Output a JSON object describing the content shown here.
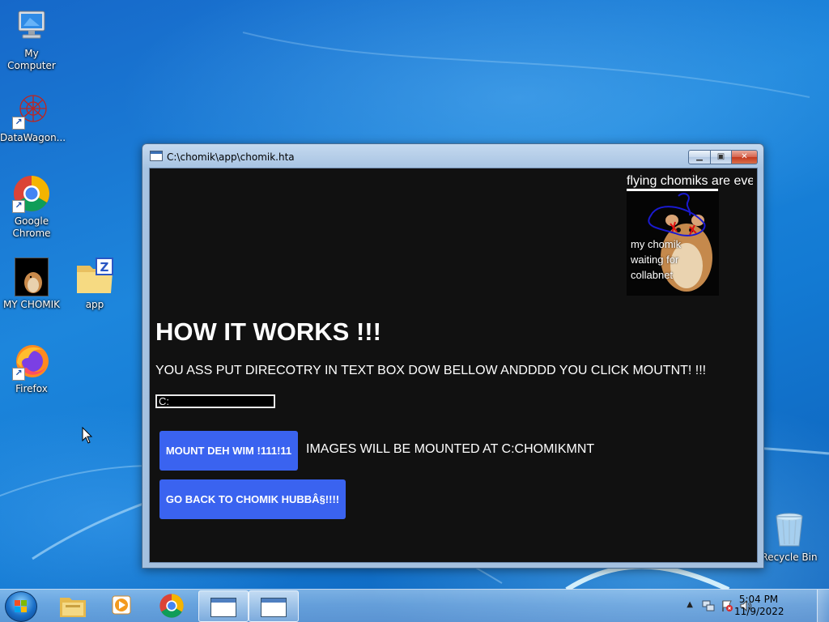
{
  "desktop": {
    "icons": [
      {
        "label": "My Computer",
        "icon": "computer-icon"
      },
      {
        "label": "DataWagon...",
        "icon": "datawagon-icon"
      },
      {
        "label": "Google Chrome",
        "icon": "chrome-icon"
      },
      {
        "label": "MY CHOMIK",
        "icon": "hamster-image-icon"
      },
      {
        "label": "app",
        "icon": "folder-zip-icon"
      },
      {
        "label": "Firefox",
        "icon": "firefox-icon"
      },
      {
        "label": "Recycle Bin",
        "icon": "recycle-bin-icon"
      }
    ],
    "thumb_text": "my chomik waiting for collabnet"
  },
  "window": {
    "title": "C:\\chomik\\app\\chomik.hta",
    "buttons": {
      "minimize": "minimize-icon",
      "maximize": "maximize-icon",
      "close": "close-icon"
    }
  },
  "content": {
    "marquee_text": "flying chomiks are eve",
    "hamster_caption": [
      "my chomik",
      "waiting for",
      "collabnet"
    ],
    "heading": "HOW IT WORKS !!!",
    "instructions": "YOU ASS PUT DIRECOTRY IN TEXT BOX DOW BELLOW ANDDDD YOU CLICK MOUTNT! !!!",
    "directory_input": "C:",
    "mount_button": "MOUNT DEH WIM !111!11",
    "mount_note": "IMAGES WILL BE MOUNTED AT C:CHOMIKMNT",
    "back_button": "GO BACK TO CHOMIK HUBBÂ§!!!!"
  },
  "taskbar": {
    "pinned": [
      "explorer-icon",
      "media-player-icon",
      "chrome-icon",
      "hta-window-icon",
      "hta-window-icon"
    ],
    "time": "5:04 PM",
    "date": "11/9/2022",
    "tray_icons": [
      "show-hidden-icons-arrow",
      "network-icon",
      "action-center-flag-icon",
      "volume-icon"
    ]
  },
  "colors": {
    "button_blue": "#3a63f0",
    "content_background": "#111111",
    "desktop_blue": "#1d86dc"
  }
}
